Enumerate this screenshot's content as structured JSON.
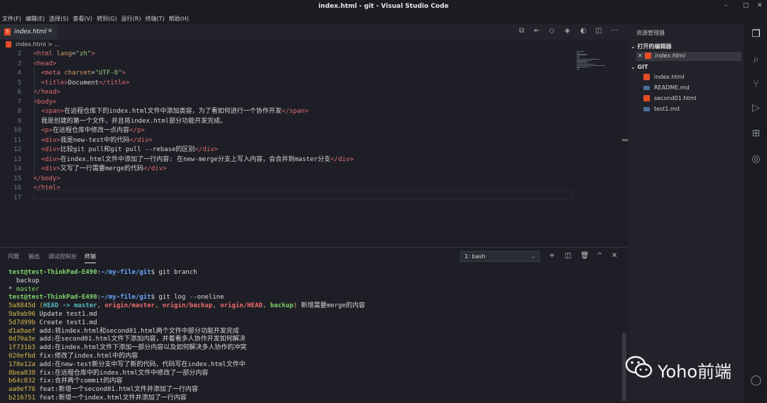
{
  "window": {
    "title": "index.html - git - Visual Studio Code",
    "controls": [
      "–",
      "▢",
      "✕"
    ]
  },
  "menu": [
    "文件(F)",
    "编辑(E)",
    "选择(S)",
    "查看(V)",
    "转到(G)",
    "运行(R)",
    "终端(T)",
    "帮助(H)"
  ],
  "editor": {
    "tab_label": "index.html",
    "tab_close": "✕",
    "breadcrumb": "index.html > ...",
    "lines": [
      {
        "n": "2",
        "html": "<span class='tg'>&lt;html</span> <span class='at'>lang</span>=<span class='st'>\"zh\"</span><span class='tg'>&gt;</span>"
      },
      {
        "n": "3",
        "html": "<span class='tg'>&lt;head&gt;</span>"
      },
      {
        "n": "4",
        "html": "  <span class='tg'>&lt;meta</span> <span class='at'>charset</span>=<span class='st'>\"UTF-8\"</span><span class='tg'>&gt;</span>"
      },
      {
        "n": "5",
        "html": "  <span class='tg'>&lt;title&gt;</span><span class='tx'>Document</span><span class='tg'>&lt;/title&gt;</span>"
      },
      {
        "n": "6",
        "html": "<span class='tg'>&lt;/head&gt;</span>"
      },
      {
        "n": "7",
        "html": "<span class='tg'>&lt;body&gt;</span>"
      },
      {
        "n": "8",
        "html": "  <span class='tg'>&lt;span&gt;</span><span class='tx'>在远程仓库下的index.html文件中添加类容，为了看如何进行一个协作开发</span><span class='tg'>&lt;/span&gt;</span>"
      },
      {
        "n": "9",
        "html": "  <span class='tx'>我是创建的第一个文件，并且将index.html部分功能开发完成。</span>"
      },
      {
        "n": "10",
        "html": "  <span class='tg'>&lt;p&gt;</span><span class='tx'>在远程仓库中修改一点内容</span><span class='tg'>&lt;/p&gt;</span>"
      },
      {
        "n": "11",
        "html": "  <span class='tg'>&lt;div&gt;</span><span class='tx'>我是new-test中的代码</span><span class='tg'>&lt;/div&gt;</span>"
      },
      {
        "n": "12",
        "html": "  <span class='tg'>&lt;div&gt;</span><span class='tx'>比较git pull和git pull --rebase的区别</span><span class='tg'>&lt;/div&gt;</span>"
      },
      {
        "n": "13",
        "html": "  <span class='tg'>&lt;div&gt;</span><span class='tx'>在index.html文件中添加了一行内容: 在new-merge分支上写入内容，会合并到master分支</span><span class='tg'>&lt;/div&gt;</span>"
      },
      {
        "n": "14",
        "html": "  <span class='tg'>&lt;div&gt;</span><span class='tx'>又写了一行需要merge的代码</span><span class='tg'>&lt;/div&gt;</span>"
      },
      {
        "n": "15",
        "html": "<span class='tg'>&lt;/body&gt;</span>"
      },
      {
        "n": "16",
        "html": "<span class='tg'>&lt;/html&gt;</span>"
      },
      {
        "n": "17",
        "html": ""
      }
    ]
  },
  "explorer": {
    "header": "资源管理器",
    "open_editors_label": "打开的编辑器",
    "open_editors": [
      {
        "name": "index.html",
        "type": "html"
      }
    ],
    "folder_label": "GIT",
    "files": [
      {
        "name": "index.html",
        "type": "html"
      },
      {
        "name": "README.md",
        "type": "md"
      },
      {
        "name": "second01.html",
        "type": "html"
      },
      {
        "name": "test1.md",
        "type": "md"
      }
    ]
  },
  "panel": {
    "tabs": [
      "问题",
      "输出",
      "调试控制台",
      "终端"
    ],
    "active_tab": "终端",
    "shell": "1: bash",
    "shell_chevron": "⌵",
    "actions": [
      "+",
      "◫",
      "🗑",
      "^",
      "✕"
    ]
  },
  "terminal": {
    "prompt_user": "test@test-ThinkPad-E490",
    "prompt_path": "~/my-file/git",
    "cmd1": "git branch",
    "branches": [
      "  backup",
      "* master"
    ],
    "cmd2": "git log --oneline",
    "head_commit": {
      "hash": "5a8845d",
      "refs": [
        "HEAD -> master",
        "origin/master",
        "origin/backup",
        "origin/HEAD",
        "backup"
      ],
      "msg": "新增需要merge的内容"
    },
    "commits": [
      {
        "hash": "9a9ab96",
        "msg": "Update test1.md"
      },
      {
        "hash": "5d7d99b",
        "msg": "Create test1.md"
      },
      {
        "hash": "d1a9aef",
        "msg": "add:将index.html和second01.html两个文件中部分功能开发完成"
      },
      {
        "hash": "0d70a3e",
        "msg": "add:在second01.html文件下添加内容，并着看多人协作开发如何解决"
      },
      {
        "hash": "1f731b3",
        "msg": "add:在index.html文件下添加一部分内容以及如何解决多人协作的冲突"
      },
      {
        "hash": "020efbd",
        "msg": "fix:修改了index.html中的内容"
      },
      {
        "hash": "178e12a",
        "msg": "add:在new-test新分支中写了新的代码，代码写在index.html文件中"
      },
      {
        "hash": "8bea838",
        "msg": "fix:在远程仓库中的index.html文件中修改了一部分内容"
      },
      {
        "hash": "b64c832",
        "msg": "fix:合并两个commit的内容"
      },
      {
        "hash": "aa0ef76",
        "msg": "feat:新增一个second01.html文件并添加了一行内容"
      },
      {
        "hash": "b216751",
        "msg": "feat:新增一个index.html文件并添加了一行内容"
      }
    ]
  },
  "watermark": {
    "text": "Yoho前端"
  }
}
